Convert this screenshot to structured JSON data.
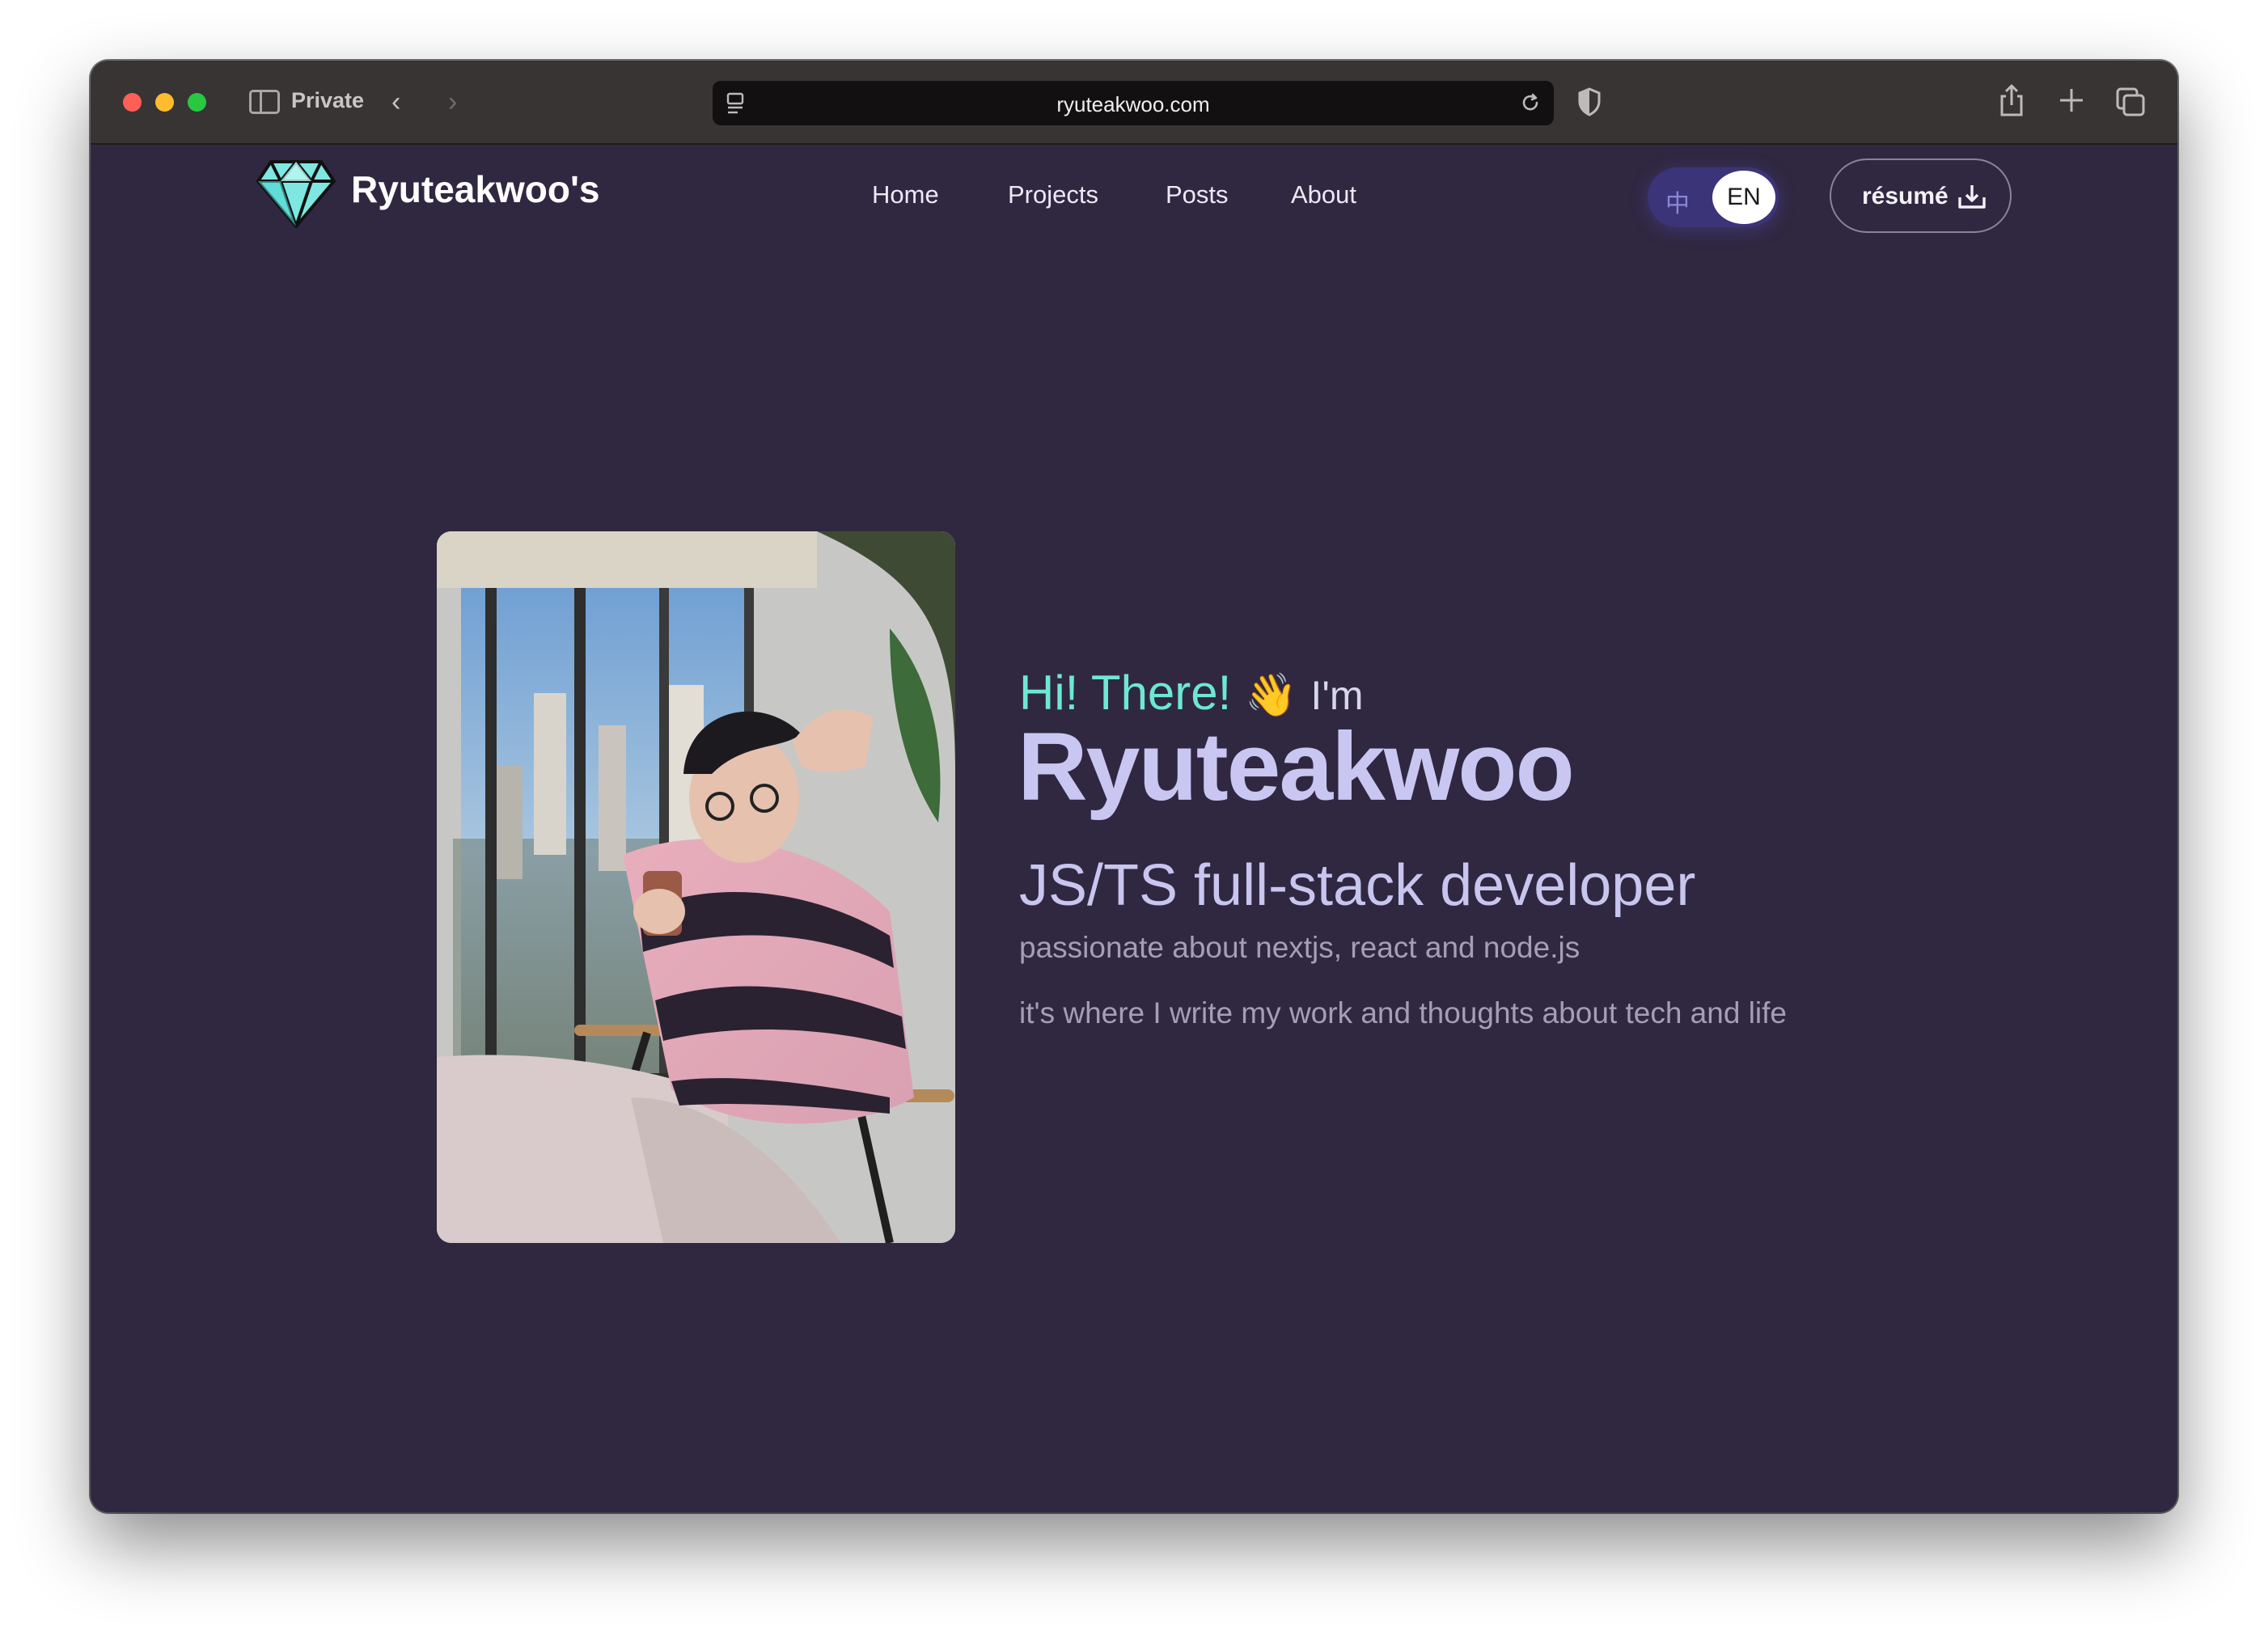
{
  "browser": {
    "private_label": "Private",
    "url": "ryuteakwoo.com",
    "icons": {
      "sidebar": "sidebar-icon",
      "back": "chevron-left-icon",
      "forward": "chevron-right-icon",
      "site": "site-info-icon",
      "reload": "reload-icon",
      "shield": "shield-icon",
      "share": "share-icon",
      "new_tab": "plus-icon",
      "tab_overview": "tabs-icon"
    },
    "traffic_lights": {
      "close": "#fe5f57",
      "minimize": "#febc2e",
      "zoom": "#28c840"
    }
  },
  "site": {
    "logo_text": "Ryuteakwoo's",
    "nav": [
      {
        "label": "Home"
      },
      {
        "label": "Projects"
      },
      {
        "label": "Posts"
      },
      {
        "label": "About"
      }
    ],
    "lang_toggle": {
      "zh": "中",
      "en": "EN",
      "selected": "EN"
    },
    "resume_label": "résumé"
  },
  "hero": {
    "greeting": "Hi! There!",
    "wave_emoji": "👋",
    "im": "I'm",
    "name": "Ryuteakwoo",
    "role": "JS/TS full-stack developer",
    "desc1": "passionate about nextjs, react and node.js",
    "desc2": "it's where I write my work and thoughts about tech and life"
  },
  "colors": {
    "page_bg": "#302841",
    "accent_teal": "#6ee7d6",
    "name_lavender": "#c9c7f2",
    "toolbar_bg": "#383434"
  }
}
